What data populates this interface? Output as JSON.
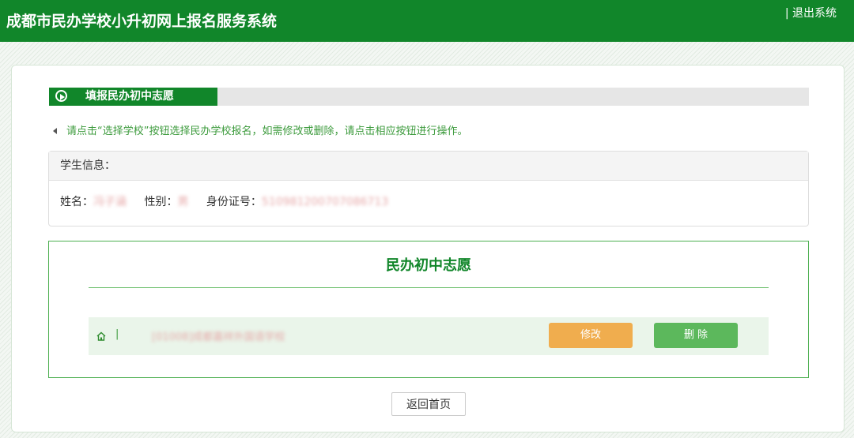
{
  "header": {
    "title": "成都市民办学校小升初网上报名服务系统",
    "logout_label": "| 退出系统"
  },
  "section": {
    "title": "填报民办初中志愿"
  },
  "tip": "请点击“选择学校”按钮选择民办学校报名，如需修改或删除，请点击相应按钮进行操作。",
  "student": {
    "header": "学生信息：",
    "name_label": "姓名：",
    "name_value": "冯子涵",
    "gender_label": "性别：",
    "gender_value": "男",
    "id_label": "身份证号：",
    "id_value": "510981200707086713"
  },
  "choice": {
    "title": "民办初中志愿",
    "pipe": "|",
    "school_value": "[01008]成都嘉祥外国语学校",
    "edit_label": "修改",
    "delete_label": "删 除"
  },
  "back_label": "返回首页",
  "colors": {
    "brand": "#11862a",
    "edit": "#f0ad4e",
    "delete": "#5cb85c"
  }
}
